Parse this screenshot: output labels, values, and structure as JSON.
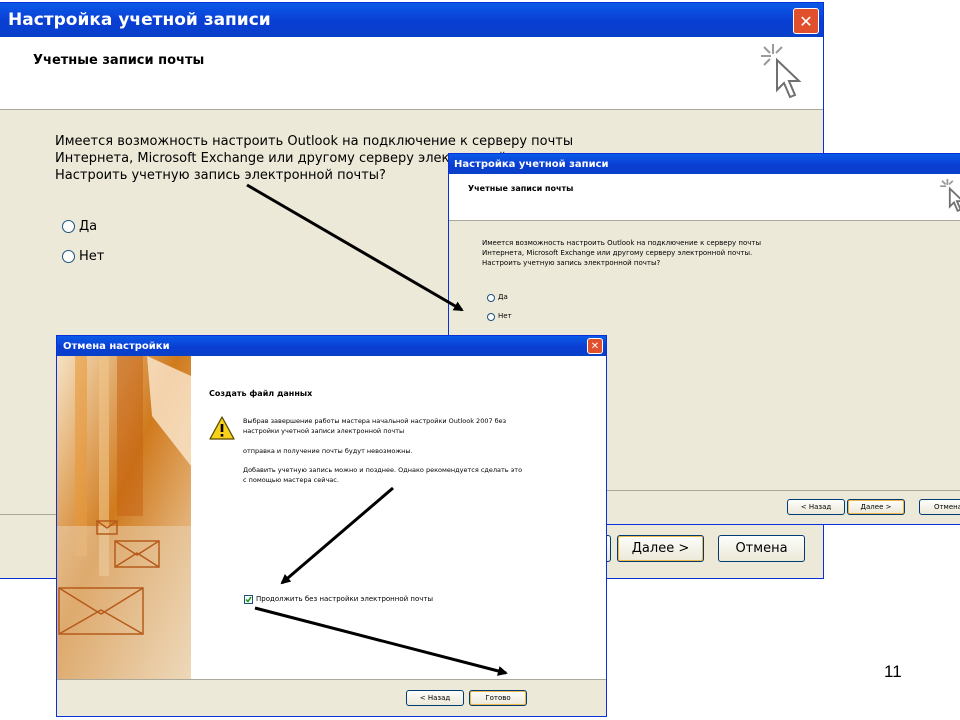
{
  "main_dialog": {
    "title": "Настройка учетной записи",
    "header_title": "Учетные записи почты",
    "question_lines": [
      "Имеется возможность настроить Outlook на подключение к серверу почты",
      "Интернета, Microsoft Exchange или другому серверу электронной почты.",
      "Настроить учетную запись электронной почты?"
    ],
    "option_yes": "Да",
    "option_no": "Нет",
    "next_button": "Далее >",
    "cancel_button": "Отмена"
  },
  "second_dialog": {
    "title": "Настройка учетной записи",
    "header_title": "Учетные записи почты",
    "question_lines": [
      "Имеется возможность настроить Outlook на подключение к серверу почты",
      "Интернета, Microsoft Exchange или другому серверу электронной почты.",
      "Настроить учетную запись электронной почты?"
    ],
    "option_yes": "Да",
    "option_no": "Нет",
    "back_button": "< Назад",
    "next_button": "Далее >",
    "cancel_button": "Отмена"
  },
  "cancel_dialog": {
    "title": "Отмена настройки",
    "heading": "Создать файл данных",
    "warning_lines": [
      "Выбрав завершение работы мастера начальной настройки Outlook 2007 без",
      "настройки учетной записи электронной почты"
    ],
    "info_line": "отправка и получение почты будут невозможны.",
    "later_lines": [
      "Добавить учетную запись можно и позднее. Однако рекомендуется сделать это",
      "с помощью мастера сейчас."
    ],
    "checkbox_label": "Продолжить без настройки электронной почты",
    "checkbox_checked": true,
    "back_button": "< Назад",
    "finish_button": "Готово"
  },
  "slide_number": "11"
}
